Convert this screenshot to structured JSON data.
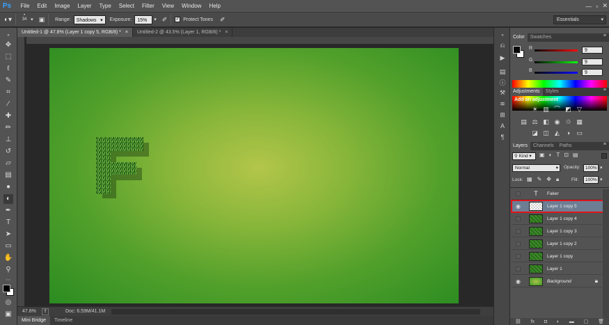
{
  "app": {
    "logo": "Ps"
  },
  "menu": [
    "File",
    "Edit",
    "Image",
    "Layer",
    "Type",
    "Select",
    "Filter",
    "View",
    "Window",
    "Help"
  ],
  "window_controls": {
    "minimize": "—",
    "maximize": "▫",
    "close": "✕"
  },
  "options": {
    "brush_size": "34",
    "range_label": "Range:",
    "range_value": "Shadows",
    "exposure_label": "Exposure:",
    "exposure_value": "15%",
    "protect_tones": "Protect Tones",
    "workspace": "Essentials"
  },
  "tabs": [
    {
      "label": "Untitled-1 @ 47.8% (Layer 1 copy 5, RGB/8) *",
      "close": "×"
    },
    {
      "label": "Untitled-2 @ 43.5% (Layer 1, RGB/8) *",
      "close": "×"
    }
  ],
  "status": {
    "zoom": "47.8%",
    "doc": "Doc: 6.59M/41.1M"
  },
  "bottom_tabs": [
    "Mini Bridge",
    "Timeline"
  ],
  "color_panel": {
    "tabs": [
      "Color",
      "Swatches"
    ],
    "r_label": "R",
    "r_value": "9",
    "g_label": "G",
    "g_value": "9",
    "b_label": "B",
    "b_value": "9"
  },
  "adjustments": {
    "tabs": [
      "Adjustments",
      "Styles"
    ],
    "title": "Add an adjustment"
  },
  "layers_panel": {
    "tabs": [
      "Layers",
      "Channels",
      "Paths"
    ],
    "kind": "Kind",
    "blend_mode": "Normal",
    "opacity_label": "Opacity:",
    "opacity_value": "100%",
    "lock_label": "Lock:",
    "fill_label": "Fill:",
    "fill_value": "100%",
    "layers": [
      {
        "name": "Faker",
        "type": "text"
      },
      {
        "name": "Layer 1 copy 5",
        "type": "empty",
        "selected": true
      },
      {
        "name": "Layer 1 copy 4",
        "type": "grass"
      },
      {
        "name": "Layer 1 copy 3",
        "type": "grass"
      },
      {
        "name": "Layer 1 copy 2",
        "type": "grass"
      },
      {
        "name": "Layer 1 copy",
        "type": "grass"
      },
      {
        "name": "Layer 1",
        "type": "grass"
      },
      {
        "name": "Background",
        "type": "background"
      }
    ],
    "footer_icons": [
      "link-icon",
      "fx-icon",
      "mask-icon",
      "adjustment-icon",
      "folder-icon",
      "new-layer-icon",
      "trash-icon"
    ]
  },
  "colors": {
    "highlight": "#e0141c",
    "selected_row": "#6d7d93",
    "accent": "#3aa3ff"
  }
}
